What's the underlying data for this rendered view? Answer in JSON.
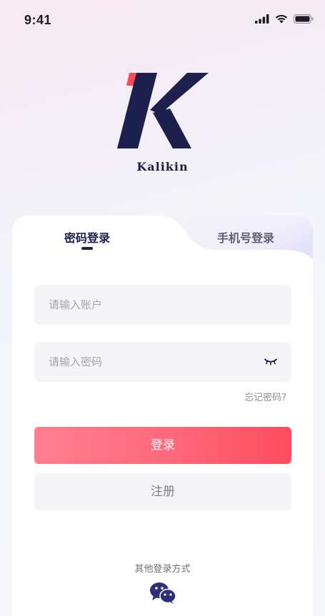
{
  "status_bar": {
    "time": "9:41"
  },
  "brand": {
    "name": "Kalikin",
    "logo_letter": "K"
  },
  "tabs": [
    {
      "label": "密码登录",
      "active": true
    },
    {
      "label": "手机号登录",
      "active": false
    }
  ],
  "form": {
    "account_placeholder": "请输入账户",
    "password_placeholder": "请输入密码",
    "forgot_label": "忘记密码?"
  },
  "buttons": {
    "login_label": "登录",
    "register_label": "注册"
  },
  "other_login": {
    "label": "其他登录方式"
  },
  "colors": {
    "accent_navy": "#1d1f4d",
    "login_gradient_start": "#ff7f90",
    "login_gradient_end": "#ff4d5f",
    "logo_red": "#ff4b57"
  },
  "icons": [
    "signal-icon",
    "wifi-icon",
    "battery-icon",
    "eye-closed-icon",
    "wechat-icon"
  ]
}
